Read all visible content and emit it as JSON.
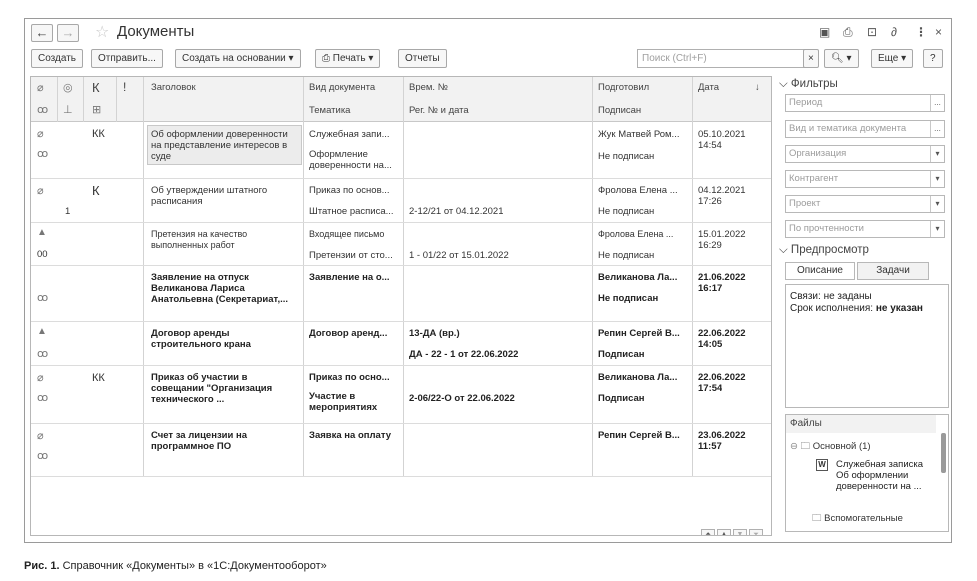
{
  "window": {
    "title": "Документы"
  },
  "toolbar": {
    "create": "Создать",
    "send": "Отправить...",
    "create_based": "Создать на основании",
    "print": "Печать",
    "reports": "Отчеты",
    "search_placeholder": "Поиск (Ctrl+F)",
    "more": "Еще",
    "help": "?"
  },
  "columns": {
    "k": "К",
    "excl": "!",
    "title": "Заголовок",
    "doc_type": "Вид документа",
    "topic": "Тематика",
    "temp_no": "Врем. №",
    "reg": "Рег. № и дата",
    "prepared": "Подготовил",
    "signed": "Подписан",
    "date": "Дата"
  },
  "rows": [
    {
      "k": "КК",
      "title": "Об оформлении доверенности на представление интересов в суде",
      "doc_type": "Служебная запи...",
      "topic": "Оформление доверенности на...",
      "temp_no": "",
      "reg": "",
      "prepared": "Жук Матвей Ром...",
      "signed": "Не подписан",
      "date": "05.10.2021",
      "time": "14:54"
    },
    {
      "k": "К",
      "count": "1",
      "title": "Об утверждении штатного расписания",
      "doc_type": "Приказ по основ...",
      "topic": "Штатное расписа...",
      "temp_no": "",
      "reg": "2-12/21 от 04.12.2021",
      "prepared": "Фролова Елена ...",
      "signed": "Не подписан",
      "date": "04.12.2021",
      "time": "17:26"
    },
    {
      "k": "",
      "count": "00",
      "title": "Претензия на качество выполненных работ",
      "doc_type": "Входящее письмо",
      "topic": "Претензии от сто...",
      "temp_no": "",
      "reg": "1 - 01/22 от 15.01.2022",
      "prepared": "Фролова Елена ...",
      "signed": "Не подписан",
      "date": "15.01.2022",
      "time": "16:29"
    },
    {
      "k": "",
      "title": "Заявление на отпуск Великанова Лариса Анатольевна (Секретариат,...",
      "doc_type": "Заявление на о...",
      "topic": "",
      "temp_no": "",
      "reg": "",
      "prepared": "Великанова Ла...",
      "signed": "Не подписан",
      "date": "21.06.2022",
      "time": "16:17"
    },
    {
      "k": "",
      "title": "Договор аренды строительного крана",
      "doc_type": "Договор аренд...",
      "topic": "",
      "temp_no": "13-ДА (вр.)",
      "reg": "ДА - 22 - 1 от 22.06.2022",
      "prepared": "Репин Сергей В...",
      "signed": "Подписан",
      "date": "22.06.2022",
      "time": "14:05"
    },
    {
      "k": "КК",
      "title": "Приказ об участии в совещании \"Организация технического ...",
      "doc_type": "Приказ по осно...",
      "topic": "Участие в мероприятиях",
      "temp_no": "",
      "reg": "2-06/22-О от 22.06.2022",
      "prepared": "Великанова Ла...",
      "signed": "Подписан",
      "date": "22.06.2022",
      "time": "17:54"
    },
    {
      "k": "",
      "title": "Счет за лицензии на программное ПО",
      "doc_type": "Заявка на оплату",
      "topic": "",
      "temp_no": "",
      "reg": "",
      "prepared": "Репин Сергей В...",
      "signed": "",
      "date": "23.06.2022",
      "time": "11:57"
    }
  ],
  "filters": {
    "header": "Фильтры",
    "period": "Период",
    "type_topic": "Вид и тематика документа",
    "organization": "Организация",
    "counterparty": "Контрагент",
    "project": "Проект",
    "unread": "По прочтенности"
  },
  "preview": {
    "header": "Предпросмотр",
    "tab_description": "Описание",
    "tab_tasks": "Задачи",
    "links_label": "Связи: не заданы",
    "deadline_label": "Срок исполнения: ",
    "deadline_value": "не указан"
  },
  "files": {
    "header": "Файлы",
    "main_folder": "Основной (1)",
    "file_name": "Служебная записка Об оформлении доверенности на ...",
    "aux_folder": "Вспомогательные"
  },
  "caption": {
    "bold": "Рис. 1.",
    "text": " Справочник «Документы» в «1С:Документооборот»"
  }
}
